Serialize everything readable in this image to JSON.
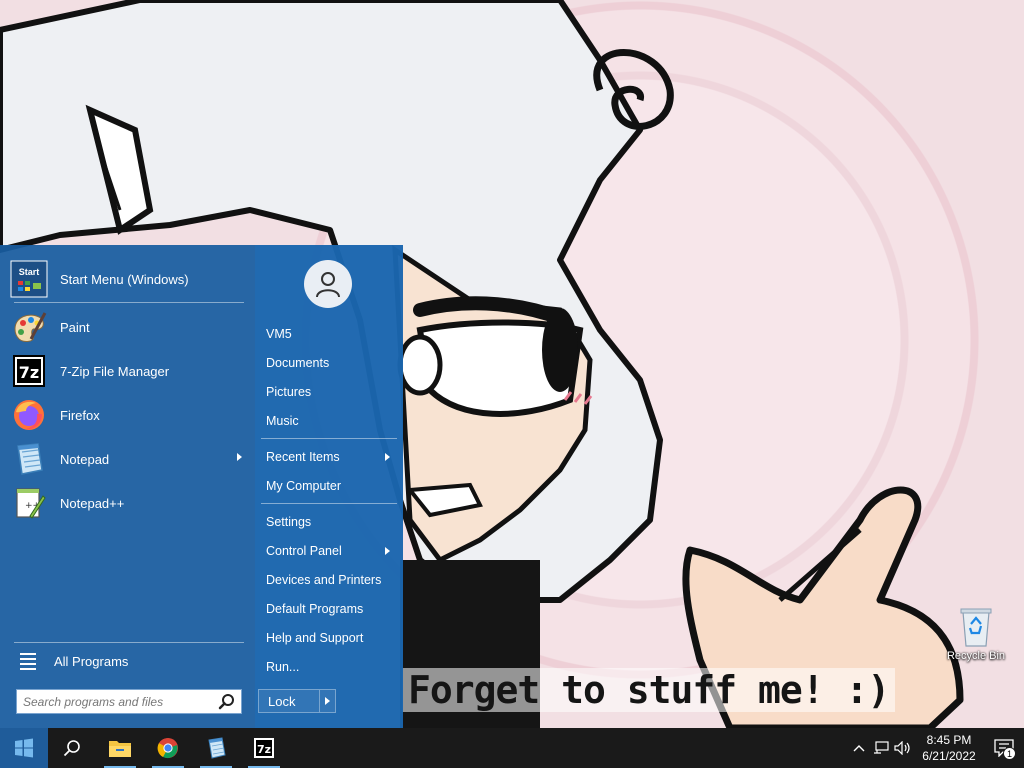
{
  "wallpaper": {
    "caption": "Forget to stuff me! :)"
  },
  "desktop": {
    "recycle_bin_label": "Recycle Bin"
  },
  "start_menu": {
    "header_item": {
      "label": "Start Menu (Windows)",
      "icon": "start-menu-app-icon"
    },
    "pinned_apps": [
      {
        "label": "Paint",
        "icon": "paint-icon",
        "has_submenu": false
      },
      {
        "label": "7-Zip File Manager",
        "icon": "7zip-icon",
        "has_submenu": false
      },
      {
        "label": "Firefox",
        "icon": "firefox-icon",
        "has_submenu": false
      },
      {
        "label": "Notepad",
        "icon": "notepad-icon",
        "has_submenu": true
      },
      {
        "label": "Notepad++",
        "icon": "notepad-plus-plus-icon",
        "has_submenu": false
      }
    ],
    "all_programs_label": "All Programs",
    "search": {
      "placeholder": "Search programs and files",
      "value": ""
    },
    "right_items": [
      {
        "label": "VM5",
        "has_submenu": false
      },
      {
        "label": "Documents",
        "has_submenu": false
      },
      {
        "label": "Pictures",
        "has_submenu": false
      },
      {
        "label": "Music",
        "has_submenu": false
      },
      {
        "label": "Recent Items",
        "has_submenu": true
      },
      {
        "label": "My Computer",
        "has_submenu": false
      },
      {
        "label": "Settings",
        "has_submenu": false
      },
      {
        "label": "Control Panel",
        "has_submenu": true
      },
      {
        "label": "Devices and Printers",
        "has_submenu": false
      },
      {
        "label": "Default Programs",
        "has_submenu": false
      },
      {
        "label": "Help and Support",
        "has_submenu": false
      },
      {
        "label": "Run...",
        "has_submenu": false
      }
    ],
    "lock_label": "Lock"
  },
  "taskbar": {
    "apps": [
      "windows-start-icon",
      "search-icon",
      "file-explorer-icon",
      "chrome-icon",
      "notepad-icon",
      "7zip-icon"
    ],
    "clock": {
      "time": "8:45 PM",
      "date": "6/21/2022"
    },
    "notification_count": "1"
  },
  "colors": {
    "menu_bg": "#185ca0",
    "taskbar_bg": "#1a1a1a",
    "accent": "#76b9ed"
  }
}
